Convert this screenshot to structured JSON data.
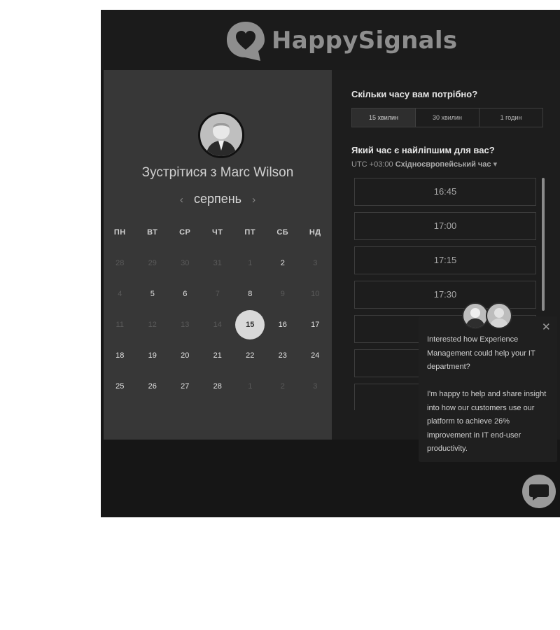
{
  "brand": {
    "name": "HappySignals"
  },
  "booking": {
    "host_title": "Зустрітися з Marc Wilson",
    "month": "серпень",
    "prev_icon": "chevron-left-icon",
    "next_icon": "chevron-right-icon",
    "weekdays": [
      "ПН",
      "ВТ",
      "СР",
      "ЧТ",
      "ПТ",
      "СБ",
      "НД"
    ],
    "weeks": [
      [
        "28",
        "29",
        "30",
        "31",
        "1",
        "2",
        "3"
      ],
      [
        "4",
        "5",
        "6",
        "7",
        "8",
        "9",
        "10"
      ],
      [
        "11",
        "12",
        "13",
        "14",
        "15",
        "16",
        "17"
      ],
      [
        "18",
        "19",
        "20",
        "21",
        "22",
        "23",
        "24"
      ],
      [
        "25",
        "26",
        "27",
        "28",
        "1",
        "2",
        "3"
      ]
    ],
    "selected_day": "15",
    "duration_question": "Скільки часу вам потрібно?",
    "durations": [
      "15 хвилин",
      "30 хвилин",
      "1 годин"
    ],
    "active_duration": "15 хвилин",
    "time_question": "Який час є найліпшим для вас?",
    "timezone_offset": "UTC +03:00",
    "timezone_name": "Східноєвропейський час",
    "timezone_arrow": "▾",
    "slots": [
      "16:45",
      "17:00",
      "17:15",
      "17:30",
      "",
      "",
      ""
    ]
  },
  "chat": {
    "popup_text_1": "Interested how Experience Management could help your IT department?",
    "popup_text_2": "I'm happy to help and share insight into how our customers use our platform to achieve 26% improvement in IT end-user productivity.",
    "close_label": "✕"
  },
  "colors": {
    "background": "#161616",
    "calendar_panel": "#373737",
    "slots_panel": "#1d1d1d",
    "selected_day": "#d9d9d9"
  }
}
